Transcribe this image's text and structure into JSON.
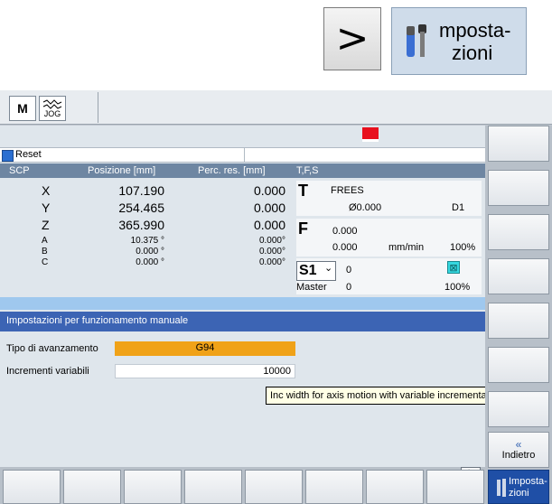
{
  "callout": {
    "next_key_glyph": ">",
    "settings_key": {
      "line1": "mposta-",
      "line2": "zioni",
      "icon": "wrench-screwdriver-icon"
    }
  },
  "header": {
    "machine_icon": "M",
    "jog_icon_label": "JOG"
  },
  "status": {
    "reset_label": "Reset"
  },
  "axes": {
    "col_scp": "SCP",
    "col_pos": "Posizione [mm]",
    "col_dist": "Perc. res. [mm]",
    "rows": [
      {
        "name": "X",
        "pos": "107.190",
        "dist": "0.000",
        "size": "big"
      },
      {
        "name": "Y",
        "pos": "254.465",
        "dist": "0.000",
        "size": "big"
      },
      {
        "name": "Z",
        "pos": "365.990",
        "dist": "0.000",
        "size": "big"
      },
      {
        "name": "A",
        "pos": "10.375 °",
        "dist": "0.000°",
        "size": "sm"
      },
      {
        "name": "B",
        "pos": "0.000 °",
        "dist": "0.000°",
        "size": "sm"
      },
      {
        "name": "C",
        "pos": "0.000 °",
        "dist": "0.000°",
        "size": "sm"
      }
    ]
  },
  "tfs": {
    "header": "T,F,S",
    "t_letter": "T",
    "tool_name": "FREES",
    "tool_diam": "Ø0.000",
    "tool_d": "D1",
    "f_letter": "F",
    "feed_set": "0.000",
    "feed_act": "0.000",
    "feed_unit": "mm/min",
    "feed_ovr": "100%",
    "s_box": "S1",
    "s_arrow": "⌄",
    "s_set": "0",
    "s_master": "Master",
    "s_act": "0",
    "s_ovr": "100%"
  },
  "settings": {
    "title": "Impostazioni per funzionamento manuale",
    "feed_type_label": "Tipo di avanzamento",
    "feed_type_value": "G94",
    "var_inc_label": "Incrementi variabili",
    "var_inc_value": "10000",
    "tooltip": "Inc width for axis motion with variable incremental step width"
  },
  "softkeys": {
    "back_chev": "«",
    "back_label": "Indietro",
    "active_line1": "Imposta-",
    "active_line2": "zioni",
    "scroll_label": ">"
  }
}
